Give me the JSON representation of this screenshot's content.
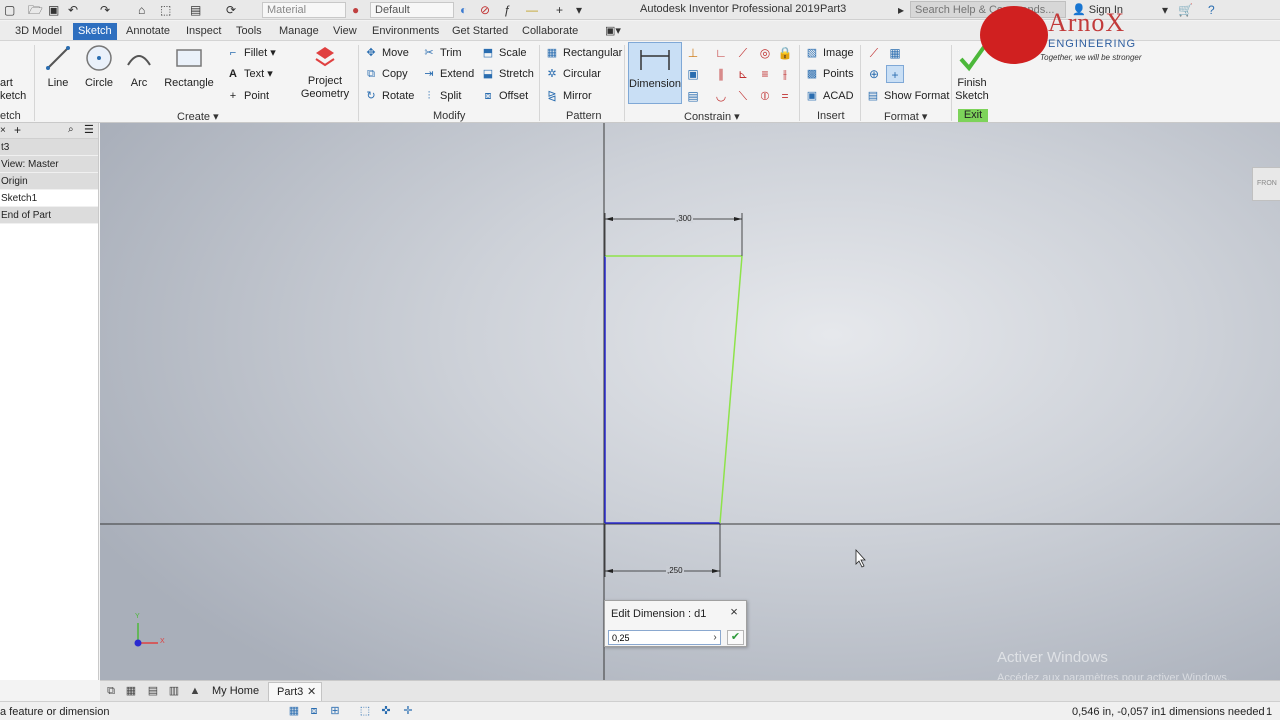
{
  "titlebar": {
    "material": "Material",
    "appearance": "Default",
    "app_title": "Autodesk Inventor Professional 2019",
    "doc_name": "Part3",
    "search_placeholder": "Search Help & Commands...",
    "sign_in": "Sign In"
  },
  "tabs": [
    "3D Model",
    "Sketch",
    "Annotate",
    "Inspect",
    "Tools",
    "Manage",
    "View",
    "Environments",
    "Get Started",
    "Collaborate"
  ],
  "ribbon": {
    "start_sketch_line1": "art",
    "start_sketch_line2": "ketch",
    "sketch_group_label": "etch",
    "create": {
      "label": "Create",
      "line": "Line",
      "circle": "Circle",
      "arc": "Arc",
      "rectangle": "Rectangle",
      "fillet": "Fillet",
      "text": "Text",
      "point": "Point",
      "project_geometry_1": "Project",
      "project_geometry_2": "Geometry"
    },
    "modify": {
      "label": "Modify",
      "move": "Move",
      "trim": "Trim",
      "scale": "Scale",
      "copy": "Copy",
      "extend": "Extend",
      "stretch": "Stretch",
      "rotate": "Rotate",
      "split": "Split",
      "offset": "Offset"
    },
    "pattern": {
      "label": "Pattern",
      "rectangular": "Rectangular",
      "circular": "Circular",
      "mirror": "Mirror"
    },
    "constrain": {
      "label": "Constrain",
      "dimension": "Dimension"
    },
    "insert": {
      "label": "Insert",
      "image": "Image",
      "points": "Points",
      "acad": "ACAD"
    },
    "format": {
      "label": "Format",
      "show_format": "Show Format"
    },
    "exit": {
      "label": "Exit",
      "finish_1": "Finish",
      "finish_2": "Sketch"
    }
  },
  "logo": {
    "name": "ArnoX",
    "engineering": "ENGINEERING",
    "tagline": "Together, we will be stronger"
  },
  "browser": {
    "items": [
      "t3",
      "View: Master",
      "Origin",
      "Sketch1",
      "End of Part"
    ]
  },
  "sketch": {
    "top_dimension": ",300",
    "bottom_dimension": ",250",
    "viewcube_label": "FRON",
    "axis_y": "Y",
    "axis_x": "X"
  },
  "edit_dimension": {
    "title": "Edit Dimension : d1",
    "value": "0,25"
  },
  "watermark": {
    "line1": "Activer Windows",
    "line2": "Accédez aux paramètres pour activer Windows."
  },
  "doc_tabs": {
    "my_home": "My Home",
    "part3": "Part3"
  },
  "status": {
    "message": "a feature or dimension",
    "coords": "0,546 in, -0,057 in",
    "dim_count": "1 dimensions needed",
    "number": "1"
  },
  "colors": {
    "active_tab": "#2e6fbf",
    "sketch_blue": "#2a2ad0",
    "sketch_green": "#8ee34a",
    "exit_green": "#7dd35a"
  }
}
